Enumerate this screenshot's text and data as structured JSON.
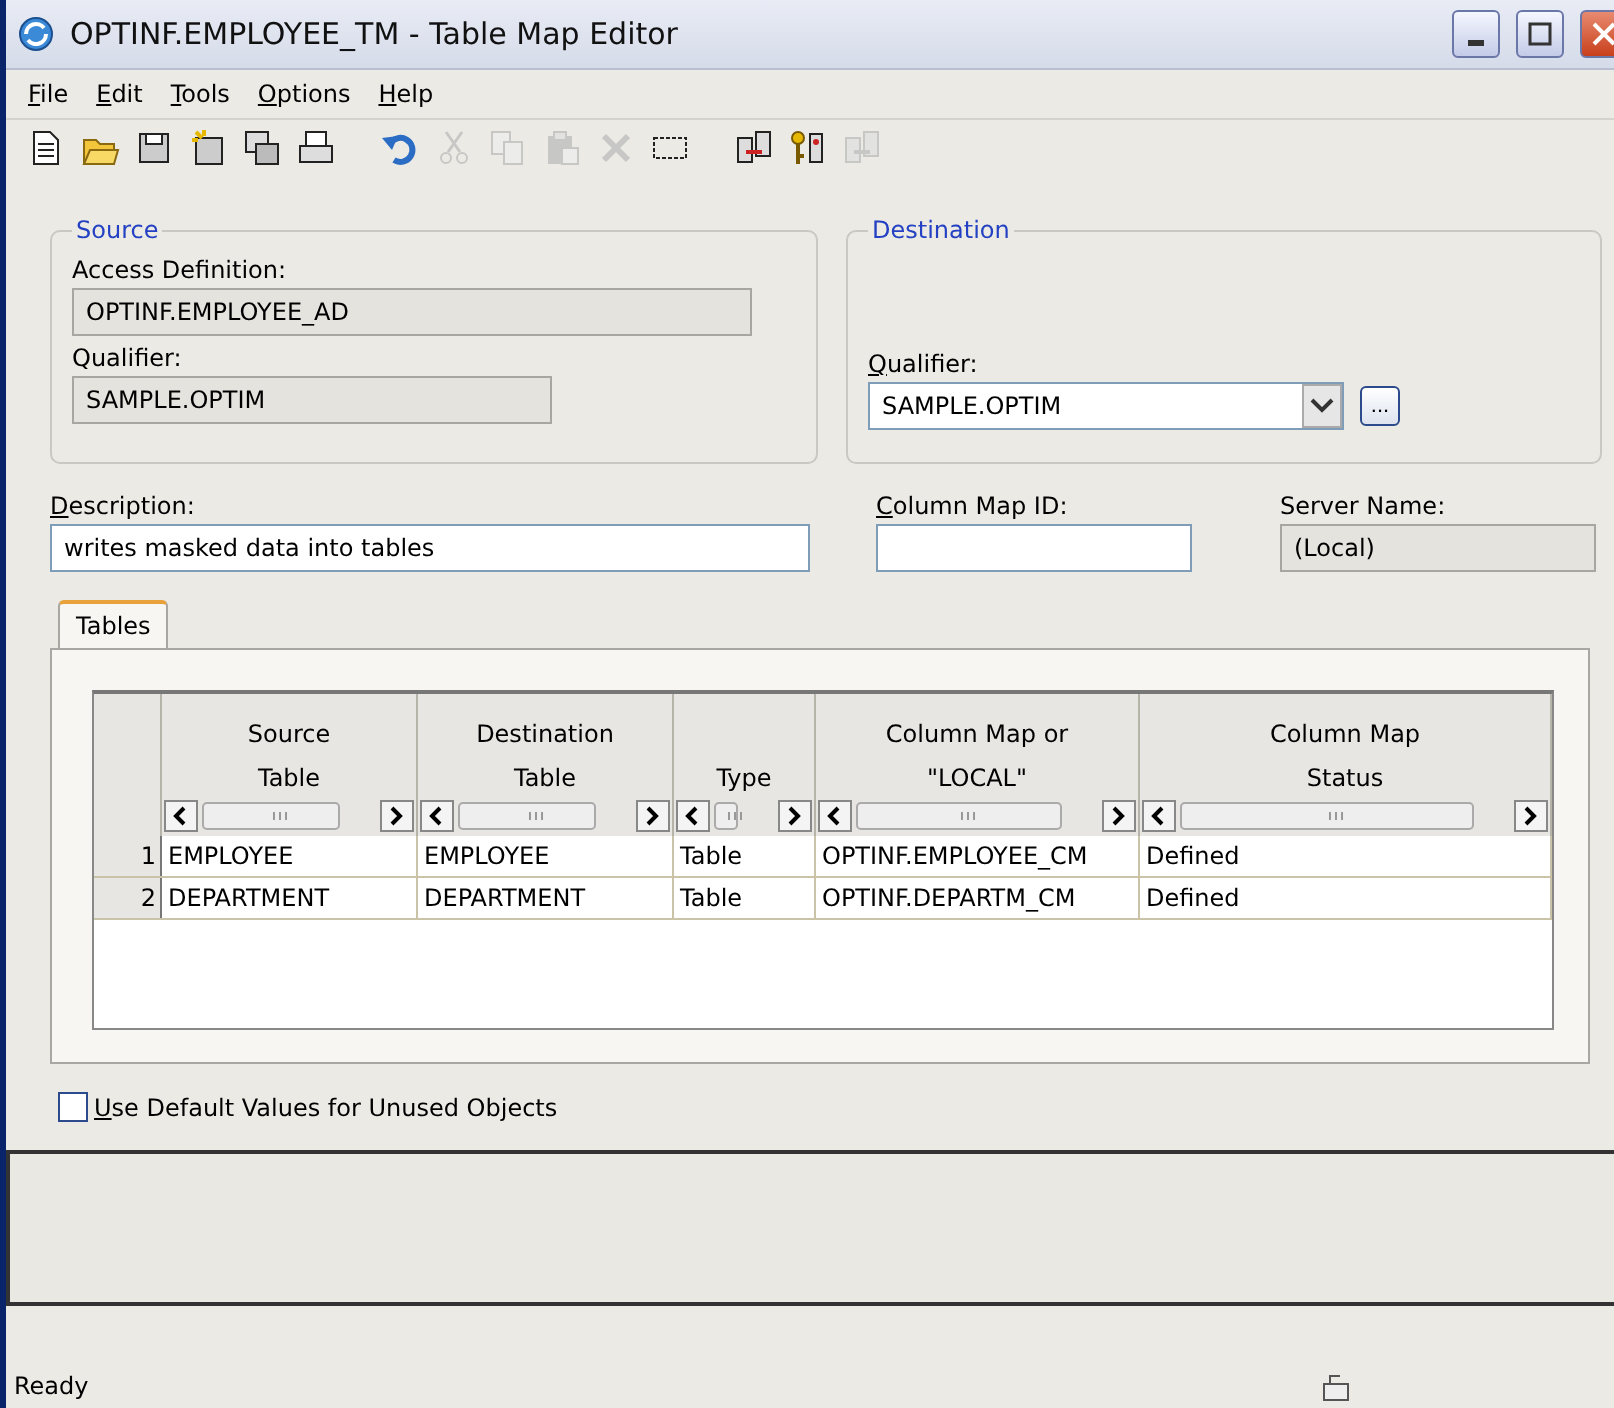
{
  "window": {
    "title": "OPTINF.EMPLOYEE_TM - Table Map Editor"
  },
  "menu": [
    "File",
    "Edit",
    "Tools",
    "Options",
    "Help"
  ],
  "toolbar": [
    {
      "kind": "new",
      "disabled": false
    },
    {
      "kind": "open",
      "disabled": false
    },
    {
      "kind": "save",
      "disabled": false
    },
    {
      "kind": "save-new",
      "disabled": false
    },
    {
      "kind": "copy-window",
      "disabled": false
    },
    {
      "kind": "print",
      "disabled": false
    },
    {
      "kind": "undo",
      "disabled": false
    },
    {
      "kind": "cut",
      "disabled": true
    },
    {
      "kind": "copy",
      "disabled": true
    },
    {
      "kind": "paste",
      "disabled": true
    },
    {
      "kind": "delete",
      "disabled": true
    },
    {
      "kind": "select",
      "disabled": false
    },
    {
      "kind": "map",
      "disabled": false
    },
    {
      "kind": "keys",
      "disabled": false
    },
    {
      "kind": "map-off",
      "disabled": true
    }
  ],
  "source": {
    "title": "Source",
    "access_definition_label": "Access Definition:",
    "access_definition": "OPTINF.EMPLOYEE_AD",
    "qualifier_label": "Qualifier:",
    "qualifier": "SAMPLE.OPTIM"
  },
  "destination": {
    "title": "Destination",
    "qualifier_label": "Qualifier:",
    "qualifier": "SAMPLE.OPTIM",
    "browse": "..."
  },
  "description": {
    "label": "Description:",
    "value": "writes masked data into tables"
  },
  "column_map_id": {
    "label": "Column Map ID:"
  },
  "server_name": {
    "label": "Server Name:",
    "value": "(Local)"
  },
  "tabs": [
    {
      "label": "Tables",
      "selected": true
    }
  ],
  "table": {
    "columns": [
      "Source\nTable",
      "Destination\nTable",
      "Type",
      "Column Map or\n\"LOCAL\"",
      "Column Map\nStatus"
    ],
    "rows": [
      {
        "number": "1",
        "cells": [
          "EMPLOYEE",
          "EMPLOYEE",
          "Table",
          "OPTINF.EMPLOYEE_CM",
          "Defined"
        ]
      },
      {
        "number": "2",
        "cells": [
          "DEPARTMENT",
          "DEPARTMENT",
          "Table",
          "OPTINF.DEPARTM_CM",
          "Defined"
        ]
      }
    ]
  },
  "use_defaults": {
    "label": "Use Default Values for Unused Objects",
    "checked": false
  },
  "status_bar": {
    "text": "Ready"
  }
}
